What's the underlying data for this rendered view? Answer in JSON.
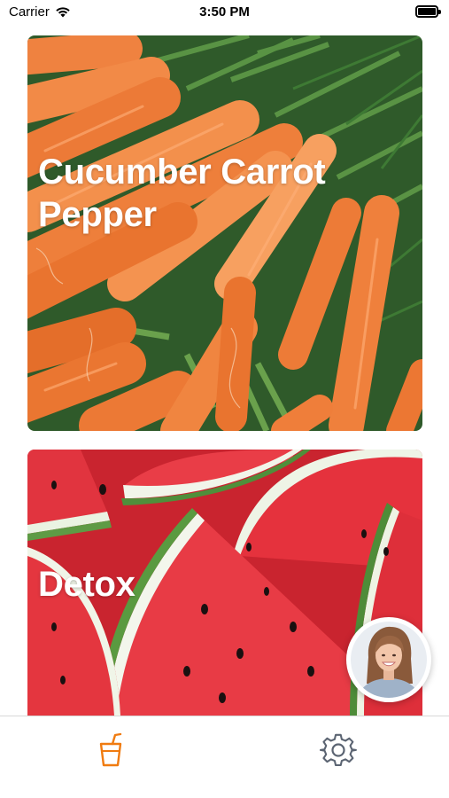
{
  "status_bar": {
    "carrier": "Carrier",
    "time": "3:50 PM",
    "icons": [
      "wifi-icon",
      "battery-icon"
    ]
  },
  "cards": [
    {
      "title": "Cucumber Carrot Pepper",
      "image": "carrots-photo"
    },
    {
      "title": "Detox",
      "image": "watermelon-photo"
    }
  ],
  "avatar": {
    "image": "user-avatar-photo"
  },
  "tab_bar": {
    "tabs": [
      {
        "icon": "juice-cup-icon",
        "selected": true
      },
      {
        "icon": "gear-icon",
        "selected": false
      }
    ]
  },
  "colors": {
    "accent": "#f07b10",
    "inactive_icon": "#5b6472",
    "card_text": "#ffffff"
  }
}
